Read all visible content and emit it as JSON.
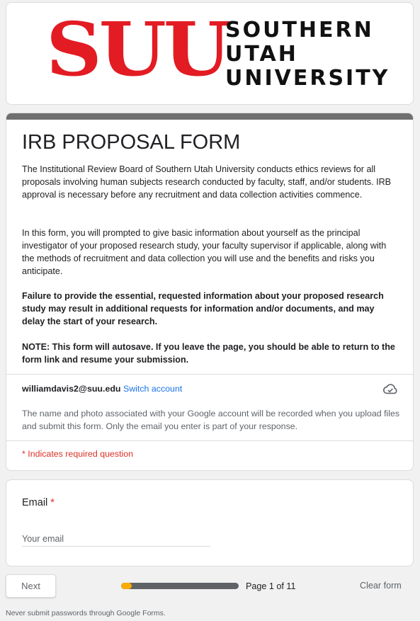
{
  "banner": {
    "logo_mark": "SUU",
    "logo_lines": [
      "SOUTHERN",
      "UTAH",
      "UNIVERSITY"
    ],
    "brand_color": "#e31b23"
  },
  "header": {
    "title": "IRB PROPOSAL FORM",
    "desc1": "The Institutional Review Board of Southern Utah University conducts ethics reviews for all proposals involving human subjects research conducted by faculty, staff, and/or students. IRB approval is necessary before any recruitment and data collection activities commence.",
    "desc2": "In this form, you will prompted to give basic information about yourself as the principal investigator of your proposed research study, your faculty supervisor if applicable, along with the methods of recruitment and data collection you will use and the benefits and risks you anticipate.",
    "desc3": "Failure to provide the essential, requested information about your proposed research study may result in additional requests for information and/or documents, and may delay the start of your research.",
    "desc4": "NOTE: This form will autosave. If you leave the page, you should be able to return to the form link and resume your submission.",
    "topbar_color": "#6f6f6f"
  },
  "account": {
    "email": "williamdavis2@suu.edu",
    "switch_label": "Switch account",
    "status_icon": "cloud-saved-icon",
    "notice": "The name and photo associated with your Google account will be recorded when you upload files and submit this form. Only the email you enter is part of your response.",
    "required_note": "* Indicates required question"
  },
  "question": {
    "label": "Email",
    "required_mark": "*",
    "placeholder": "Your email",
    "value": ""
  },
  "footer": {
    "next_label": "Next",
    "progress_fraction": 0.09,
    "page_indicator": "Page 1 of 11",
    "clear_label": "Clear form",
    "warning": "Never submit passwords through Google Forms."
  }
}
